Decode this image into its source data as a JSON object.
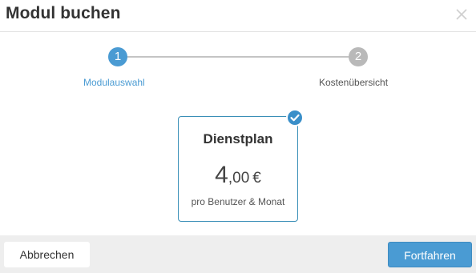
{
  "dialog": {
    "title": "Modul buchen"
  },
  "stepper": {
    "steps": [
      {
        "number": "1",
        "label": "Modulauswahl",
        "state": "active"
      },
      {
        "number": "2",
        "label": "Kostenübersicht",
        "state": "inactive"
      }
    ]
  },
  "module_card": {
    "name": "Dienstplan",
    "price_integer": "4",
    "price_decimal": ",00",
    "currency": "€",
    "price_unit": "pro Benutzer & Monat",
    "selected": true
  },
  "footer": {
    "cancel_label": "Abbrechen",
    "next_label": "Fortfahren"
  },
  "colors": {
    "accent": "#4a9bd3",
    "inactive_step": "#b9b9b9",
    "card_border": "#3a8fb7",
    "footer_bg": "#eeeeee"
  },
  "icons": {
    "close": "close-icon",
    "selected": "checkmark-icon"
  }
}
